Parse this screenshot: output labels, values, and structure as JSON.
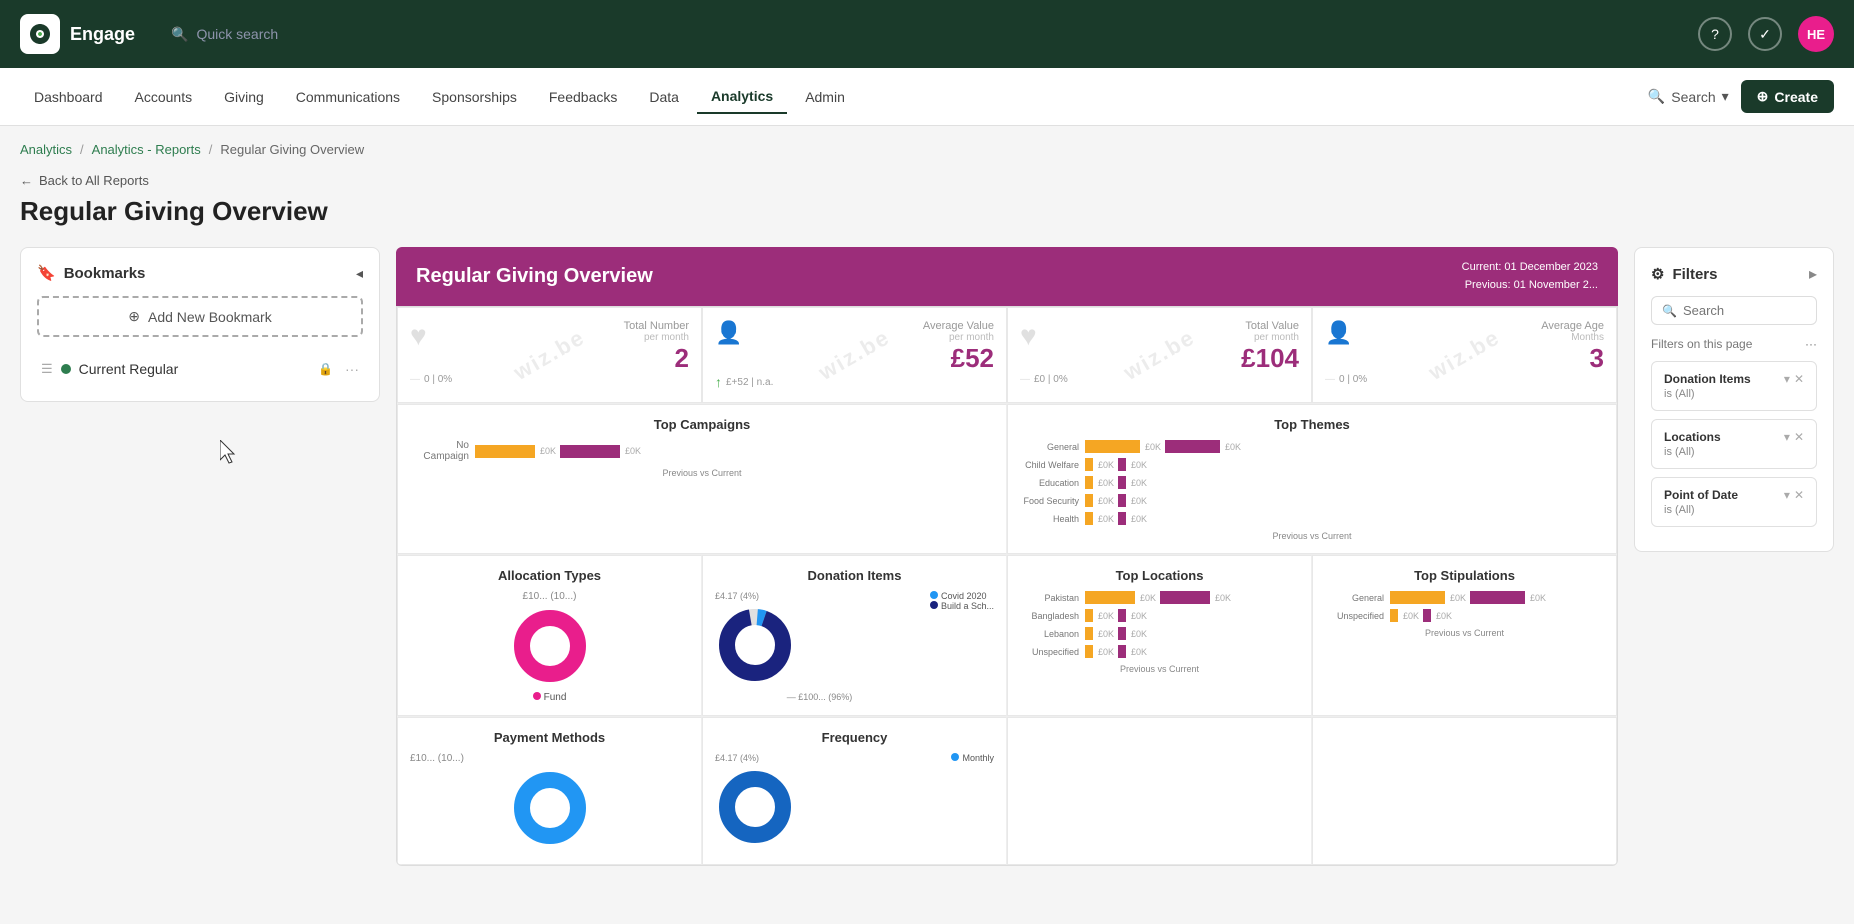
{
  "app": {
    "name": "Engage",
    "quick_search": "Quick search",
    "avatar": "HE"
  },
  "nav": {
    "items": [
      {
        "label": "Dashboard",
        "active": false
      },
      {
        "label": "Accounts",
        "active": false
      },
      {
        "label": "Giving",
        "active": false
      },
      {
        "label": "Communications",
        "active": false
      },
      {
        "label": "Sponsorships",
        "active": false
      },
      {
        "label": "Feedbacks",
        "active": false
      },
      {
        "label": "Data",
        "active": false
      },
      {
        "label": "Analytics",
        "active": true
      },
      {
        "label": "Admin",
        "active": false
      }
    ],
    "search_label": "Search",
    "create_label": "Create"
  },
  "breadcrumb": {
    "items": [
      "Analytics",
      "Analytics - Reports",
      "Regular Giving Overview"
    ]
  },
  "page": {
    "back_label": "Back to All Reports",
    "title": "Regular Giving Overview"
  },
  "bookmarks": {
    "title": "Bookmarks",
    "add_label": "Add New Bookmark",
    "items": [
      {
        "label": "Current Regular",
        "active": true
      }
    ]
  },
  "dashboard": {
    "title": "Regular Giving Overview",
    "current": "Current:  01 December 2023",
    "previous": "Previous: 01 November 2...",
    "stats": [
      {
        "label": "Total Number",
        "sub": "per month",
        "value": "2",
        "footer": "0 | 0%"
      },
      {
        "label": "Average Value",
        "sub": "per month",
        "value": "£52",
        "footer": "£+52 | n.a."
      },
      {
        "label": "Total Value",
        "sub": "per month",
        "value": "£104",
        "footer": "£0 | 0%"
      },
      {
        "label": "Average Age",
        "sub": "Months",
        "value": "3",
        "footer": "0 | 0%"
      }
    ],
    "top_campaigns": {
      "title": "Top Campaigns",
      "rows": [
        {
          "label": "No Campaign",
          "prev": 35,
          "curr": 35,
          "prev_label": "£0K",
          "curr_label": "£0K"
        }
      ]
    },
    "top_themes": {
      "title": "Top Themes",
      "rows": [
        {
          "label": "General",
          "prev": 45,
          "curr": 45,
          "prev_label": "£0K",
          "curr_label": "£0K"
        },
        {
          "label": "Child Welfare",
          "prev": 8,
          "curr": 8,
          "prev_label": "£0K",
          "curr_label": "£0K"
        },
        {
          "label": "Education",
          "prev": 8,
          "curr": 8,
          "prev_label": "£0K",
          "curr_label": "£0K"
        },
        {
          "label": "Food Security",
          "prev": 8,
          "curr": 8,
          "prev_label": "£0K",
          "curr_label": "£0K"
        },
        {
          "label": "Health",
          "prev": 8,
          "curr": 8,
          "prev_label": "£0K",
          "curr_label": "£0K"
        }
      ]
    },
    "allocation_types": {
      "title": "Allocation Types",
      "legend": "Fund",
      "legend_label": "£10... (10...)",
      "color": "#e91e8c"
    },
    "donation_items": {
      "title": "Donation Items",
      "segments": [
        {
          "label": "Covid 2020",
          "value": "£4.17 (4%)",
          "color": "#2196f3"
        },
        {
          "label": "Build a Sch...",
          "value": "",
          "color": "#1a237e"
        }
      ],
      "center": "£100... (96%)"
    },
    "top_locations": {
      "title": "Top Locations",
      "rows": [
        {
          "label": "Pakistan",
          "prev": 35,
          "curr": 35,
          "prev_label": "£0K",
          "curr_label": "£0K"
        },
        {
          "label": "Bangladesh",
          "prev": 8,
          "curr": 8,
          "prev_label": "£0K",
          "curr_label": "£0K"
        },
        {
          "label": "Lebanon",
          "prev": 8,
          "curr": 8,
          "prev_label": "£0K",
          "curr_label": "£0K"
        },
        {
          "label": "Unspecified",
          "prev": 8,
          "curr": 8,
          "prev_label": "£0K",
          "curr_label": "£0K"
        }
      ]
    },
    "top_stipulations": {
      "title": "Top Stipulations",
      "rows": [
        {
          "label": "General",
          "prev": 45,
          "curr": 45,
          "prev_label": "£0K",
          "curr_label": "£0K"
        },
        {
          "label": "Unspecified",
          "prev": 8,
          "curr": 8,
          "prev_label": "£0K",
          "curr_label": "£0K"
        }
      ]
    },
    "payment_methods": {
      "title": "Payment Methods",
      "color": "#2196f3"
    },
    "frequency": {
      "title": "Frequency",
      "legend": "Monthly",
      "color": "#2196f3"
    }
  },
  "filters": {
    "title": "Filters",
    "search_placeholder": "Search",
    "on_page_label": "Filters on this page",
    "items": [
      {
        "name": "Donation Items",
        "value": "is (All)"
      },
      {
        "name": "Locations",
        "value": "is (All)"
      },
      {
        "name": "Point of Date",
        "value": "is (All)"
      }
    ]
  },
  "icons": {
    "search": "🔍",
    "back_arrow": "←",
    "bookmark": "🔖",
    "collapse": "◂",
    "expand": "▸",
    "plus_circle": "⊕",
    "menu": "☰",
    "lock": "🔒",
    "dots": "···",
    "chevron_down": "▾",
    "filter": "⚙",
    "clear": "✕",
    "check": "✓",
    "question": "?",
    "plus": "+"
  }
}
